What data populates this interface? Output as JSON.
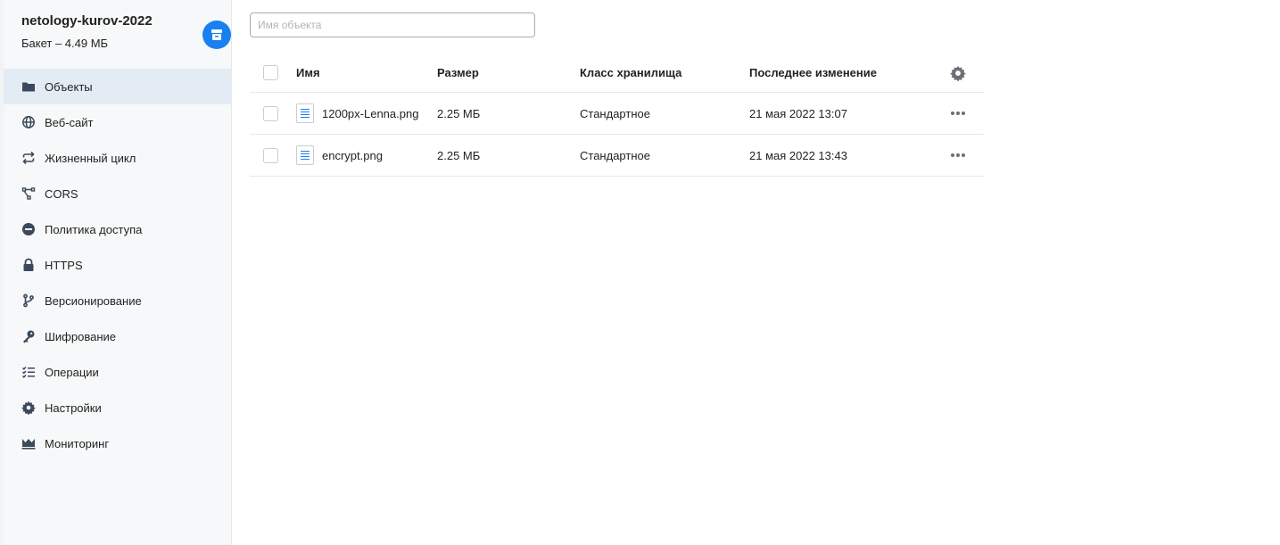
{
  "bucket": {
    "name": "netology-kurov-2022",
    "size": "Бакет – 4.49 МБ"
  },
  "colors": {
    "accent": "#1a7ff0",
    "active_bg": "#e3ecf5",
    "sidebar_bg": "#f7f8f9",
    "icon": "#3a4a5c"
  },
  "sidebar": {
    "items": [
      {
        "label": "Объекты",
        "icon": "folder-icon",
        "active": true
      },
      {
        "label": "Веб-сайт",
        "icon": "globe-icon"
      },
      {
        "label": "Жизненный цикл",
        "icon": "cycle-arrows-icon"
      },
      {
        "label": "CORS",
        "icon": "nodes-icon"
      },
      {
        "label": "Политика доступа",
        "icon": "minus-circle-icon"
      },
      {
        "label": "HTTPS",
        "icon": "lock-icon"
      },
      {
        "label": "Версионирование",
        "icon": "branch-icon"
      },
      {
        "label": "Шифрование",
        "icon": "key-icon"
      },
      {
        "label": "Операции",
        "icon": "checklist-icon"
      },
      {
        "label": "Настройки",
        "icon": "gear-icon"
      },
      {
        "label": "Мониторинг",
        "icon": "crown-chart-icon"
      }
    ]
  },
  "search": {
    "placeholder": "Имя объекта",
    "value": ""
  },
  "table": {
    "columns": {
      "name": "Имя",
      "size": "Размер",
      "storage_class": "Класс хранилища",
      "modified": "Последнее изменение"
    },
    "rows": [
      {
        "name": "1200px-Lenna.png",
        "size": "2.25 МБ",
        "storage_class": "Стандартное",
        "modified": "21 мая 2022 13:07"
      },
      {
        "name": "encrypt.png",
        "size": "2.25 МБ",
        "storage_class": "Стандартное",
        "modified": "21 мая 2022 13:43"
      }
    ]
  }
}
